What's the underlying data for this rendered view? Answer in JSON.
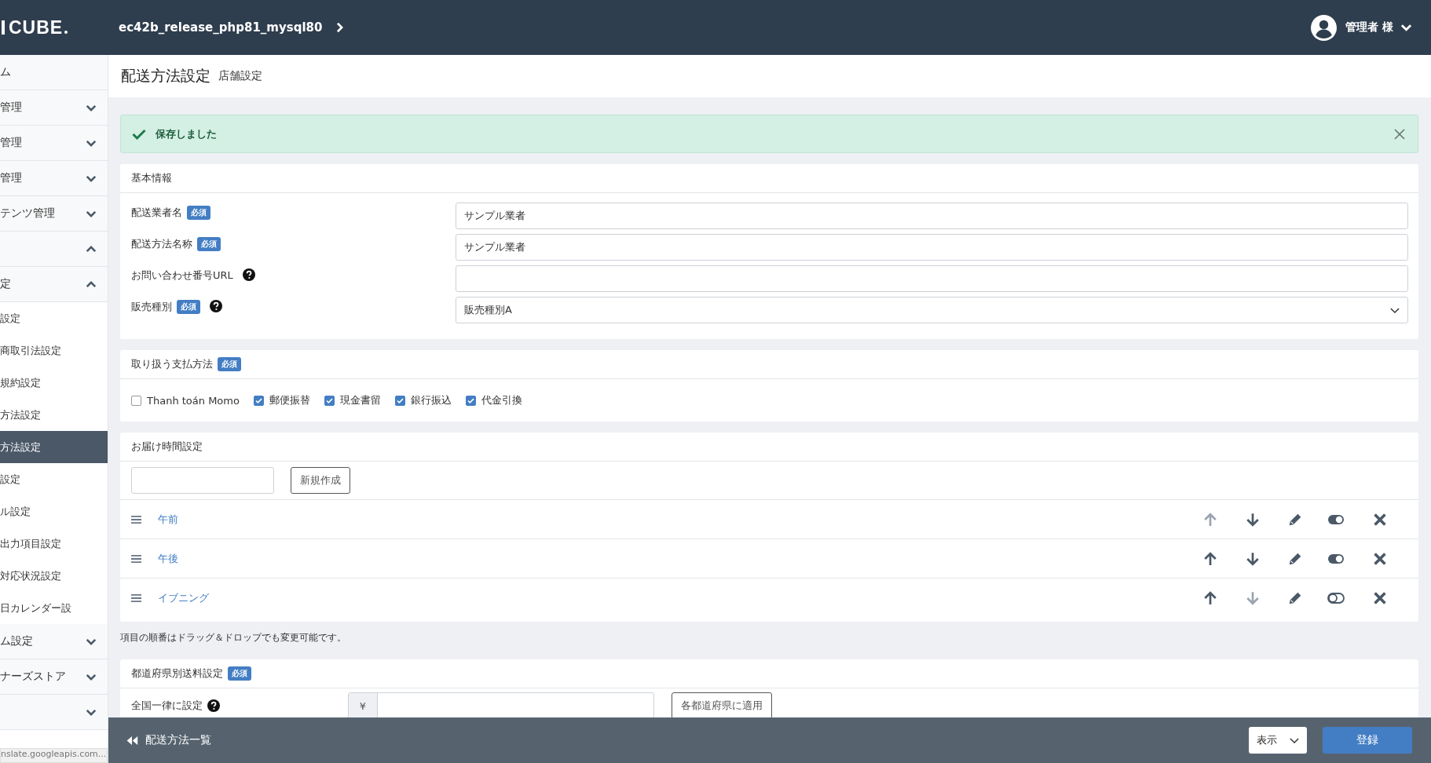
{
  "header": {
    "logo": "CUBE",
    "shop_name": "ec42b_release_php81_mysql80",
    "user": "管理者 様"
  },
  "sidebar": {
    "items": [
      {
        "kind": "link",
        "label": "ム"
      },
      {
        "kind": "group",
        "label": "管理",
        "expanded": false
      },
      {
        "kind": "group",
        "label": "管理",
        "expanded": false
      },
      {
        "kind": "group",
        "label": "管理",
        "expanded": false
      },
      {
        "kind": "group",
        "label": "テンツ管理",
        "expanded": false
      },
      {
        "kind": "group",
        "expanded": true
      },
      {
        "kind": "group",
        "label": "定",
        "expanded": true
      },
      {
        "kind": "subitem",
        "label": "設定",
        "selected": false
      },
      {
        "kind": "subitem",
        "label": "商取引法設定",
        "selected": false
      },
      {
        "kind": "subitem",
        "label": "規約設定",
        "selected": false
      },
      {
        "kind": "subitem",
        "label": "方法設定",
        "selected": false
      },
      {
        "kind": "subitem",
        "label": "方法設定",
        "selected": true
      },
      {
        "kind": "subitem",
        "label": "設定",
        "selected": false
      },
      {
        "kind": "subitem",
        "label": "ル設定",
        "selected": false
      },
      {
        "kind": "subitem",
        "label": "出力項目設定",
        "selected": false
      },
      {
        "kind": "subitem",
        "label": "対応状況設定",
        "selected": false
      },
      {
        "kind": "subitem",
        "label": "日カレンダー設",
        "selected": false
      },
      {
        "kind": "group",
        "label": "ム設定",
        "expanded": false
      },
      {
        "kind": "group",
        "label": "ナーズストア",
        "expanded": false
      },
      {
        "kind": "group",
        "expanded": false
      }
    ]
  },
  "status_bar": "nslate.googleapis.com...",
  "page": {
    "title": "配送方法設定",
    "subtitle": "店舗設定"
  },
  "alert": {
    "message": "保存しました"
  },
  "basic_info": {
    "title": "基本情報",
    "fields": [
      {
        "label": "配送業者名",
        "badge": "必須",
        "help": false,
        "kind": "text",
        "value": "サンプル業者"
      },
      {
        "label": "配送方法名称",
        "badge": "必須",
        "help": false,
        "kind": "text",
        "value": "サンプル業者"
      },
      {
        "label": "お問い合わせ番号URL",
        "help": true,
        "kind": "text"
      },
      {
        "label": "販売種別",
        "badge": "必須",
        "help": true,
        "kind": "select",
        "value": "販売種別A"
      }
    ]
  },
  "payment": {
    "title": "取り扱う支払方法",
    "badge": "必須",
    "methods": [
      {
        "label": "Thanh toán Momo",
        "checked": false
      },
      {
        "label": "郵便振替",
        "checked": true
      },
      {
        "label": "現金書留",
        "checked": true
      },
      {
        "label": "銀行振込",
        "checked": true
      },
      {
        "label": "代金引換",
        "checked": true
      }
    ]
  },
  "delivery_times": {
    "title": "お届け時間設定",
    "new_button": "新規作成",
    "items": [
      {
        "name": "午前",
        "visible": true,
        "can_move_up": false,
        "can_move_down": true
      },
      {
        "name": "午後",
        "visible": true,
        "can_move_up": true,
        "can_move_down": true
      },
      {
        "name": "イブニング",
        "visible": false,
        "can_move_up": true,
        "can_move_down": false
      }
    ],
    "note": "項目の順番はドラッグ＆ドロップでも変更可能です。"
  },
  "fees": {
    "title": "都道府県別送料設定",
    "badge": "必須",
    "uniform": {
      "label": "全国一律に設定",
      "currency": "¥",
      "button": "各都道府県に適用"
    }
  },
  "footer": {
    "back_link": "配送方法一覧",
    "visibility": "表示",
    "submit": "登録"
  }
}
